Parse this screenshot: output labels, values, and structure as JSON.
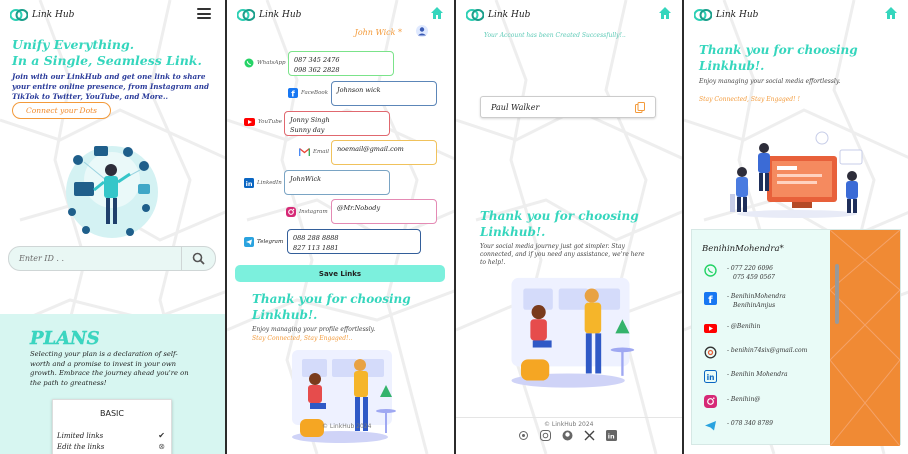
{
  "app": {
    "name": "Link Hub"
  },
  "screen1": {
    "hero_line1": "Unify Everything.",
    "hero_line2": "In a Single, Seamless Link.",
    "hero_sub": "Join with our LinkHub and get one link to share your entire online presence, from Instagram and TikTok to Twitter, YouTube, and More..",
    "connect_button": "Connect your Dots",
    "search_placeholder": "Enter ID . .",
    "plans_title": "PLANS",
    "plans_text": "Selecting your plan is a declaration of self-worth and a promise to invest in your own growth. Embrace the journey ahead you're on the path to greatness!",
    "plan_name": "BASIC",
    "plan_features": [
      "Limited links",
      "Edit the links"
    ]
  },
  "screen2": {
    "user_name": "John Wick *",
    "links": [
      {
        "label": "WhatsApp",
        "value_lines": [
          "087 345 2476",
          "098 362 2828"
        ]
      },
      {
        "label": "FaceBook",
        "value_lines": [
          "Johnson wick"
        ]
      },
      {
        "label": "YouTube",
        "value_lines": [
          "Jonny Singh",
          "Sunny day"
        ]
      },
      {
        "label": "Email",
        "value_lines": [
          "noemail@gmail.com"
        ]
      },
      {
        "label": "LinkedIn",
        "value_lines": [
          "JohnWick"
        ]
      },
      {
        "label": "Instagram",
        "value_lines": [
          "@Mr.Nobody"
        ]
      },
      {
        "label": "Telegram",
        "value_lines": [
          "088 288 8888",
          "827 113 1881"
        ]
      }
    ],
    "save_button": "Save Links",
    "thanks_line1": "Thank you for choosing",
    "thanks_line2": "Linkhub!.",
    "thanks_sub": "Enjoy managing your profile effortlessly.",
    "stay": "Stay Connected, Stay Engaged!..",
    "footer": "© LinkHub 2024"
  },
  "screen3": {
    "created_msg": "Your Account has been Created Successfully!..",
    "id_value": "Paul Walker",
    "thanks_line1": "Thank you for choosing",
    "thanks_line2": "Linkhub!.",
    "thanks_sub": "Your social media journey just got simpler. Stay connected, and if you need any assistance, we're here to help!.",
    "footer": "© LinkHub 2024"
  },
  "screen4": {
    "thanks_line1": "Thank you for choosing",
    "thanks_line2": "Linkhub!.",
    "thanks_sub": "Enjoy managing your social media effortlessly.",
    "stay": "Stay Connected, Stay Engaged! !",
    "profile_name": "BenihinMohendra*",
    "contacts": [
      {
        "icon": "whatsapp-icon",
        "lines": [
          "- 077 220 6096",
          "075 459 0567"
        ]
      },
      {
        "icon": "facebook-icon",
        "lines": [
          "- BenihinMohendra",
          "BenihinAmjus"
        ]
      },
      {
        "icon": "youtube-icon",
        "lines": [
          "- @Benihin"
        ]
      },
      {
        "icon": "email-icon",
        "lines": [
          "- benihin74six@gmail.com"
        ]
      },
      {
        "icon": "linkedin-icon",
        "lines": [
          "- Benihin Mohendra"
        ]
      },
      {
        "icon": "instagram-icon",
        "lines": [
          "- Benihin@"
        ]
      },
      {
        "icon": "telegram-icon",
        "lines": [
          "- 078 340 8789"
        ]
      }
    ]
  },
  "colors": {
    "teal": "#35d6bd",
    "orange": "#f39a3a",
    "plans_bg": "#d7f6f1",
    "save": "#7cf0dd"
  }
}
